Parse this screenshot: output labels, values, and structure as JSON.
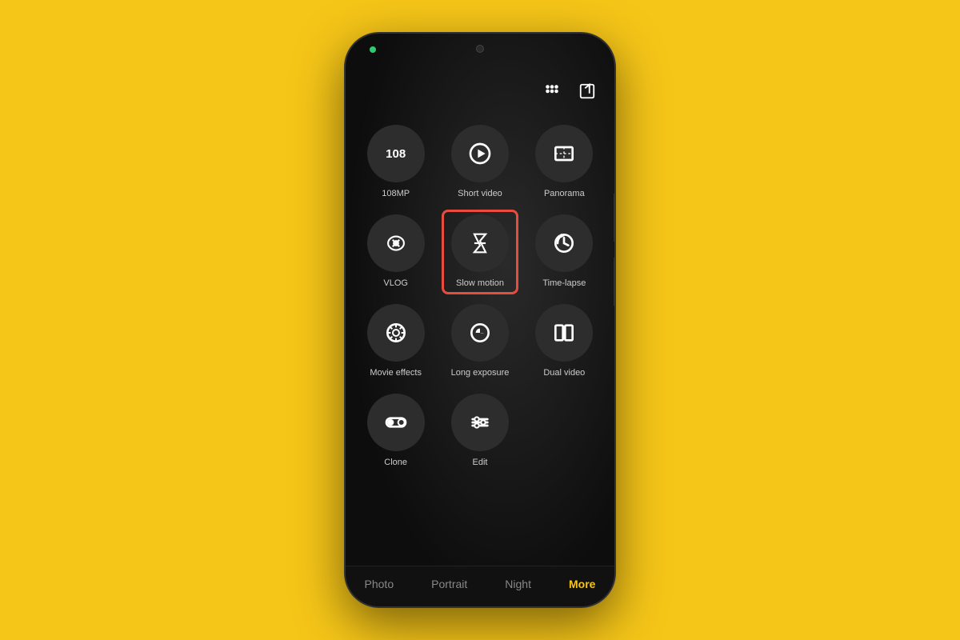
{
  "phone": {
    "background_color": "#F5C518"
  },
  "header": {
    "grid_icon": "grid-icon",
    "share_icon": "share-icon"
  },
  "modes": [
    {
      "id": "108mp",
      "label": "108MP",
      "icon_text": "108",
      "type": "text"
    },
    {
      "id": "short-video",
      "label": "Short video",
      "icon_type": "play-circle"
    },
    {
      "id": "panorama",
      "label": "Panorama",
      "icon_type": "panorama"
    },
    {
      "id": "vlog",
      "label": "VLOG",
      "icon_type": "vlog"
    },
    {
      "id": "slow-motion",
      "label": "Slow motion",
      "icon_type": "slow-motion",
      "highlighted": true
    },
    {
      "id": "time-lapse",
      "label": "Time-lapse",
      "icon_type": "time-lapse"
    },
    {
      "id": "movie-effects",
      "label": "Movie effects",
      "icon_type": "movie-effects"
    },
    {
      "id": "long-exposure",
      "label": "Long exposure",
      "icon_type": "long-exposure"
    },
    {
      "id": "dual-video",
      "label": "Dual video",
      "icon_type": "dual-video"
    },
    {
      "id": "clone",
      "label": "Clone",
      "icon_type": "clone"
    },
    {
      "id": "edit",
      "label": "Edit",
      "icon_type": "edit"
    }
  ],
  "bottom_nav": [
    {
      "id": "photo",
      "label": "Photo",
      "active": false
    },
    {
      "id": "portrait",
      "label": "Portrait",
      "active": false
    },
    {
      "id": "night",
      "label": "Night",
      "active": false
    },
    {
      "id": "more",
      "label": "More",
      "active": true
    }
  ]
}
